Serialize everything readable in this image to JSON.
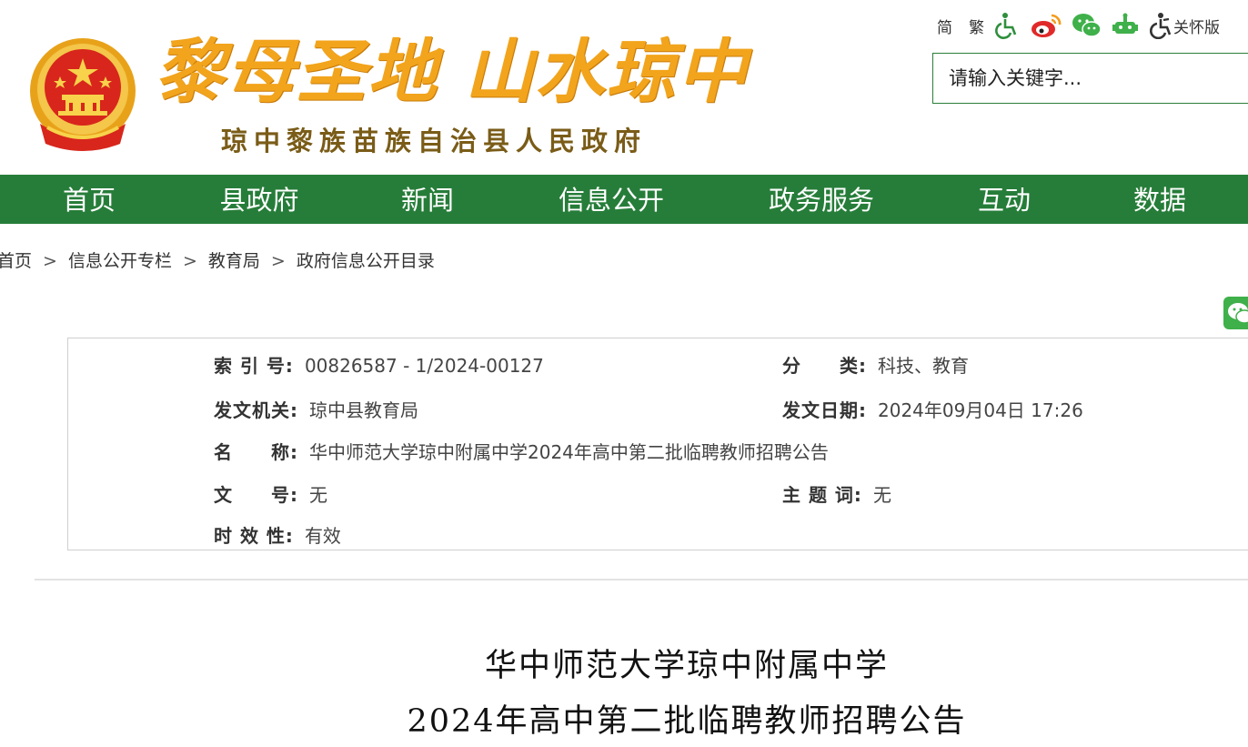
{
  "header": {
    "slogan": "黎母圣地 山水琼中",
    "subtitle": "琼中黎族苗族自治县人民政府"
  },
  "toolbar": {
    "simplified": "简",
    "traditional": "繁",
    "care_mode": "关怀版",
    "icons": [
      "accessibility-icon",
      "weibo-icon",
      "wechat-icon",
      "robot-icon",
      "elderly-care-icon"
    ]
  },
  "search": {
    "placeholder": "请输入关键字..."
  },
  "nav": {
    "items": [
      "首页",
      "县政府",
      "新闻",
      "信息公开",
      "政务服务",
      "互动",
      "数据"
    ]
  },
  "breadcrumb": [
    "首页",
    "信息公开专栏",
    "教育局",
    "政府信息公开目录"
  ],
  "info": {
    "index_label": "索 引 号:",
    "index_value": "00826587 - 1/2024-00127",
    "category_label": "分　　类:",
    "category_value": "科技、教育",
    "issuer_label": "发文机关:",
    "issuer_value": "琼中县教育局",
    "date_label": "发文日期:",
    "date_value": "2024年09月04日 17:26",
    "name_label": "名　　称:",
    "name_value": "华中师范大学琼中附属中学2024年高中第二批临聘教师招聘公告",
    "docno_label": "文　　号:",
    "docno_value": "无",
    "keyword_label": "主 题 词:",
    "keyword_value": "无",
    "validity_label": "时 效 性:",
    "validity_value": "有效"
  },
  "article": {
    "title_line1": "华中师范大学琼中附属中学",
    "title_line2": "2024年高中第二批临聘教师招聘公告"
  },
  "colors": {
    "nav_green": "#267d39",
    "slogan_gold": "#f2a41c",
    "emblem_red": "#d8261c",
    "wechat_green": "#3fb04a"
  }
}
